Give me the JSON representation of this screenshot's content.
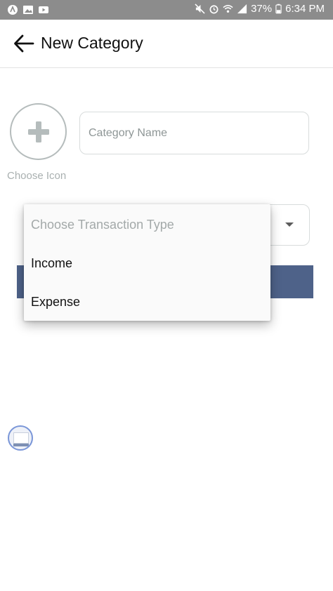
{
  "status_bar": {
    "left_icons": [
      "app-icon",
      "image-icon",
      "youtube-icon"
    ],
    "right_icons": [
      "mute-icon",
      "alarm-icon",
      "wifi-icon",
      "signal-icon"
    ],
    "battery_percent": "37%",
    "battery_icon": "battery-icon",
    "time": "6:34 PM"
  },
  "app_bar": {
    "back_icon": "arrow-back-icon",
    "title": "New Category"
  },
  "form": {
    "choose_icon_label": "Choose Icon",
    "category_name_placeholder": "Category Name",
    "transaction_type_icon": "dropdown-caret-icon"
  },
  "dropdown": {
    "hint": "Choose Transaction Type",
    "options": [
      "Income",
      "Expense"
    ]
  },
  "colors": {
    "status_bar": "#8c8c8c",
    "save_bar": "#4e6289",
    "bubble_border": "#7a96d8"
  }
}
